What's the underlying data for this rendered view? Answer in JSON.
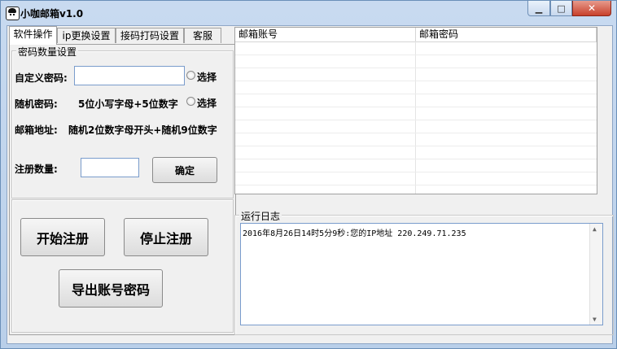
{
  "window": {
    "title": "小咖邮箱v1.0"
  },
  "tabs": [
    {
      "label": "软件操作"
    },
    {
      "label": "ip更换设置"
    },
    {
      "label": "接码打码设置"
    },
    {
      "label": "客服"
    }
  ],
  "password_group": {
    "legend": "密码数量设置",
    "custom_label": "自定义密码:",
    "custom_value": "",
    "select1": "选择",
    "random_label": "随机密码:",
    "random_desc": "5位小写字母+5位数字",
    "select2": "选择",
    "email_label": "邮箱地址:",
    "email_desc": "随机2位数字母开头+随机9位数字",
    "count_label": "注册数量:",
    "count_value": "",
    "confirm": "确定"
  },
  "actions": {
    "start": "开始注册",
    "stop": "停止注册",
    "export": "导出账号密码"
  },
  "table": {
    "columns": [
      "邮箱账号",
      "邮箱密码"
    ],
    "rows": []
  },
  "log": {
    "legend": "运行日志",
    "lines": [
      "2016年8月26日14时5分9秒:您的IP地址 220.249.71.235"
    ]
  },
  "colors": {
    "title_bar": "#c8daf0",
    "close": "#c8412c"
  }
}
